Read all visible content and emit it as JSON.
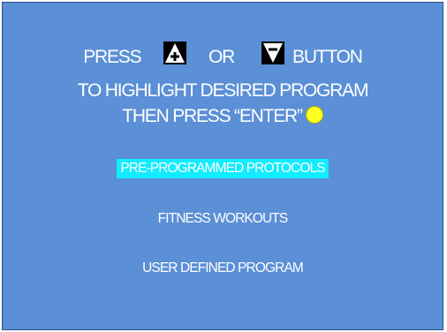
{
  "instructions": {
    "press": "PRESS",
    "or": "OR",
    "button": "BUTTON",
    "line2": "TO HIGHLIGHT DESIRED PROGRAM",
    "line3": "THEN PRESS “ENTER”"
  },
  "icons": {
    "up": "up-arrow-button-icon",
    "down": "down-arrow-button-icon",
    "enter": "enter-button-icon"
  },
  "menu": {
    "selected_index": 0,
    "items": [
      {
        "label": "PRE-PROGRAMMED PROTOCOLS"
      },
      {
        "label": "FITNESS WORKOUTS"
      },
      {
        "label": "USER DEFINED PROGRAM"
      }
    ]
  },
  "colors": {
    "background": "#5b8fd6",
    "highlight": "#11ecff",
    "enter_button": "#ffff22",
    "text": "#ffffff"
  }
}
